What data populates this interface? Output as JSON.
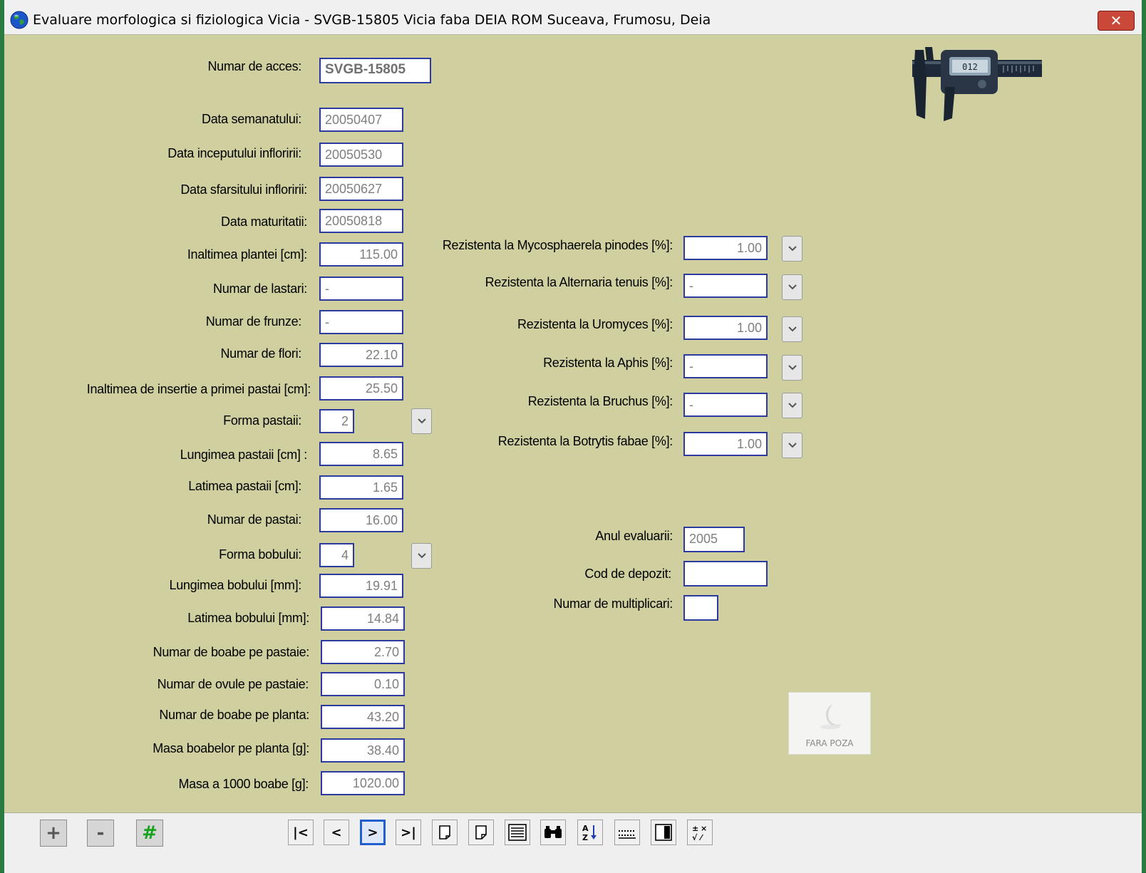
{
  "window": {
    "title": "Evaluare morfologica si fiziologica Vicia - SVGB-15805 Vicia faba DEIA ROM Suceava, Frumosu, Deia",
    "close_label": "✕"
  },
  "left_fields": [
    {
      "label": "Numar de acces:",
      "value": "SVGB-15805"
    },
    {
      "label": "Data semanatului:",
      "value": "20050407"
    },
    {
      "label": "Data inceputului infloririi:",
      "value": "20050530"
    },
    {
      "label": "Data sfarsitului infloririi:",
      "value": "20050627"
    },
    {
      "label": "Data maturitatii:",
      "value": "20050818"
    },
    {
      "label": "Inaltimea plantei [cm]:",
      "value": "115.00"
    },
    {
      "label": "Numar de lastari:",
      "value": "-"
    },
    {
      "label": "Numar de frunze:",
      "value": "-"
    },
    {
      "label": "Numar de flori:",
      "value": "22.10"
    },
    {
      "label": "Inaltimea de insertie a primei pastai [cm]:",
      "value": "25.50"
    },
    {
      "label": "Forma pastaii:",
      "value": "2"
    },
    {
      "label": "Lungimea pastaii [cm] :",
      "value": "8.65"
    },
    {
      "label": "Latimea pastaii [cm]:",
      "value": "1.65"
    },
    {
      "label": "Numar de pastai:",
      "value": "16.00"
    },
    {
      "label": "Forma bobului:",
      "value": "4"
    },
    {
      "label": "Lungimea bobului [mm]:",
      "value": "19.91"
    },
    {
      "label": "Latimea bobului [mm]:",
      "value": "14.84"
    },
    {
      "label": "Numar de boabe pe pastaie:",
      "value": "2.70"
    },
    {
      "label": "Numar de ovule pe pastaie:",
      "value": "0.10"
    },
    {
      "label": "Numar de boabe pe planta:",
      "value": "43.20"
    },
    {
      "label": "Masa boabelor pe planta [g]:",
      "value": "38.40"
    },
    {
      "label": "Masa a 1000 boabe [g]:",
      "value": "1020.00"
    }
  ],
  "resistance_fields": [
    {
      "label": "Rezistenta la Mycosphaerela pinodes [%]:",
      "value": "1.00"
    },
    {
      "label": "Rezistenta la Alternaria tenuis [%]:",
      "value": "-"
    },
    {
      "label": "Rezistenta la Uromyces [%]:",
      "value": "1.00"
    },
    {
      "label": "Rezistenta la Aphis [%]:",
      "value": "-"
    },
    {
      "label": "Rezistenta la Bruchus [%]:",
      "value": "-"
    },
    {
      "label": "Rezistenta la Botrytis fabae [%]:",
      "value": "1.00"
    }
  ],
  "other_fields": [
    {
      "label": "Anul evaluarii:",
      "value": "2005"
    },
    {
      "label": "Cod de depozit:",
      "value": ""
    },
    {
      "label": "Numar de multiplicari:",
      "value": ""
    }
  ],
  "photo_placeholder": "FARA POZA",
  "toolbar": {
    "add": "+",
    "remove": "-",
    "number": "#",
    "first": "|<",
    "prev": "<",
    "next": ">",
    "last": ">|"
  },
  "colors": {
    "form_bg": "#cfcf9f",
    "field_border": "#2b3a9c",
    "field_text": "#7f7f7f",
    "window_frame": "#2a7b42"
  }
}
